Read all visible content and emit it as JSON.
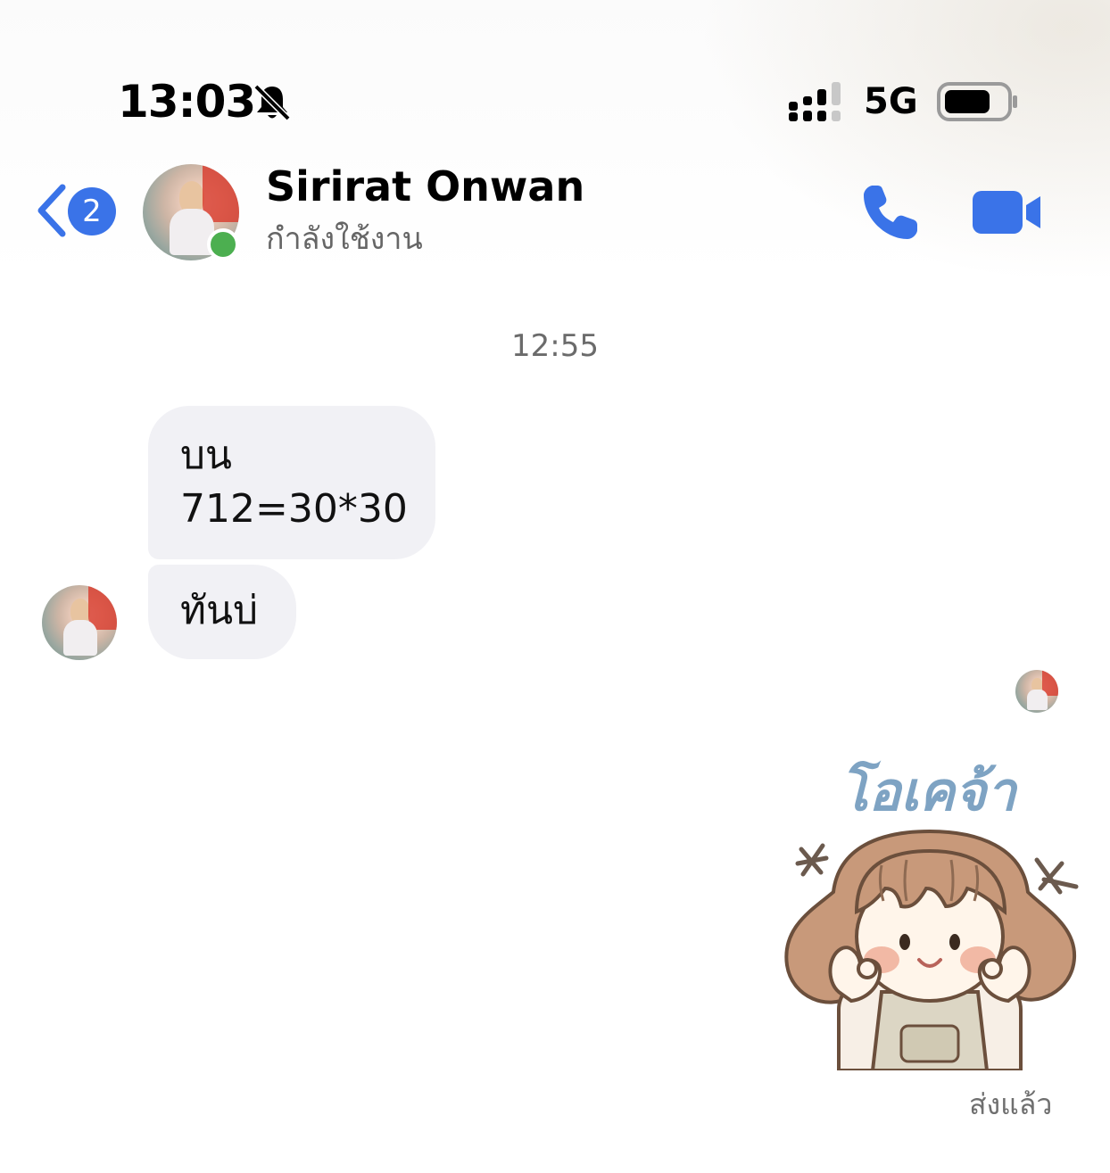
{
  "status_bar": {
    "time": "13:03",
    "network": "5G",
    "icons": [
      "bell-slash-icon",
      "signal-icon",
      "battery-icon"
    ]
  },
  "header": {
    "back_badge": "2",
    "contact_name": "Sirirat Onwan",
    "presence": "กำลังใช้งาน",
    "accent_color": "#3a73e8",
    "online_color": "#4caf50"
  },
  "conversation": {
    "timestamp": "12:55",
    "incoming": [
      {
        "lines": [
          "บน",
          "712=30*30"
        ]
      },
      {
        "lines": [
          "ทันบ่"
        ]
      }
    ],
    "outgoing_sticker": {
      "text": "โอเคจ้า"
    },
    "delivery_status": "ส่งแล้ว"
  }
}
